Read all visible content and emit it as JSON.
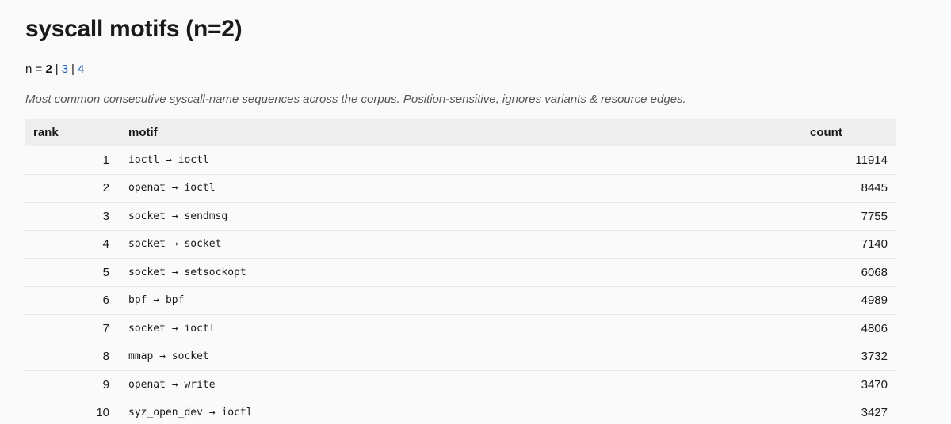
{
  "page": {
    "title": "syscall motifs (n=2)",
    "nav": {
      "prefix": "n = ",
      "current": "2",
      "separator": "|",
      "links": [
        "3",
        "4"
      ]
    },
    "description": "Most common consecutive syscall-name sequences across the corpus. Position-sensitive, ignores variants & resource edges."
  },
  "table": {
    "headers": {
      "rank": "rank",
      "motif": "motif",
      "count": "count"
    },
    "rows": [
      {
        "rank": "1",
        "motif": "ioctl → ioctl",
        "count": "11914"
      },
      {
        "rank": "2",
        "motif": "openat → ioctl",
        "count": "8445"
      },
      {
        "rank": "3",
        "motif": "socket → sendmsg",
        "count": "7755"
      },
      {
        "rank": "4",
        "motif": "socket → socket",
        "count": "7140"
      },
      {
        "rank": "5",
        "motif": "socket → setsockopt",
        "count": "6068"
      },
      {
        "rank": "6",
        "motif": "bpf → bpf",
        "count": "4989"
      },
      {
        "rank": "7",
        "motif": "socket → ioctl",
        "count": "4806"
      },
      {
        "rank": "8",
        "motif": "mmap → socket",
        "count": "3732"
      },
      {
        "rank": "9",
        "motif": "openat → write",
        "count": "3470"
      },
      {
        "rank": "10",
        "motif": "syz_open_dev → ioctl",
        "count": "3427"
      }
    ]
  }
}
